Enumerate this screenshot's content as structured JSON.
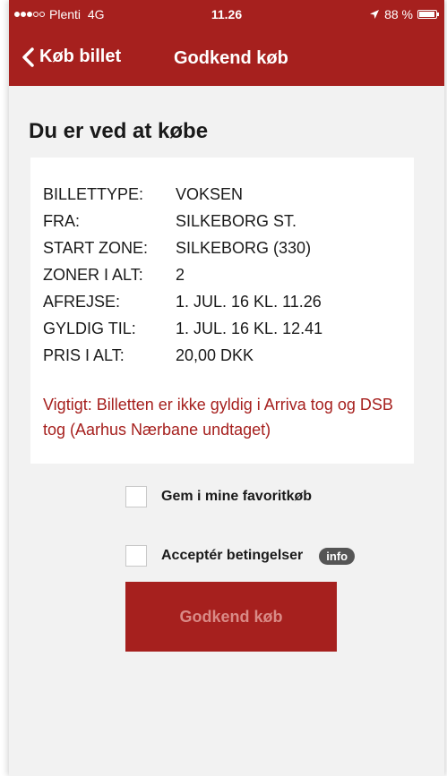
{
  "status_bar": {
    "carrier": "Plenti",
    "network": "4G",
    "time": "11.26",
    "battery_percent": "88 %",
    "battery_level": 0.88,
    "signal_bars_filled": 3,
    "signal_bars_total": 5
  },
  "nav": {
    "back_label": "Køb billet",
    "title": "Godkend køb"
  },
  "heading": "Du er ved at købe",
  "ticket": {
    "rows": [
      {
        "label": "BILLETTYPE:",
        "value": "VOKSEN"
      },
      {
        "label": "FRA:",
        "value": "SILKEBORG ST."
      },
      {
        "label": "START ZONE:",
        "value": "SILKEBORG (330)"
      },
      {
        "label": "ZONER I ALT:",
        "value": "2"
      },
      {
        "label": "AFREJSE:",
        "value": "1. JUL. 16 KL. 11.26"
      },
      {
        "label": "GYLDIG TIL:",
        "value": "1. JUL. 16 KL. 12.41"
      },
      {
        "label": "PRIS I ALT:",
        "value": "20,00 DKK"
      }
    ],
    "warning": "Vigtigt: Billetten er ikke gyldig i Arriva tog og DSB tog (Aarhus Nærbane undtaget)"
  },
  "options": {
    "favorite_label": "Gem i mine favoritkøb",
    "favorite_checked": false,
    "terms_label": "Acceptér betingelser",
    "terms_checked": false,
    "info_label": "info"
  },
  "confirm_button": "Godkend køb",
  "colors": {
    "brand_red": "#a6201e",
    "background": "#f2f2f2",
    "disabled_text": "#d98a86"
  }
}
